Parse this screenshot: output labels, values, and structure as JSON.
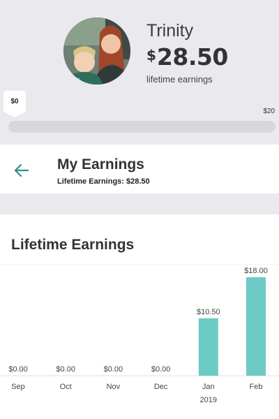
{
  "profile": {
    "name": "Trinity",
    "currency_symbol": "$",
    "amount": "28.50",
    "subtitle": "lifetime earnings"
  },
  "goal": {
    "start_label": "$0",
    "end_label": "$20",
    "progress_fraction": 0
  },
  "earnings_header": {
    "title": "My Earnings",
    "subtitle": "Lifetime Earnings: $28.50"
  },
  "chart_data": {
    "type": "bar",
    "title": "Lifetime Earnings",
    "categories": [
      "Sep",
      "Oct",
      "Nov",
      "Dec",
      "Jan",
      "Feb"
    ],
    "values": [
      0,
      0,
      0,
      0,
      10.5,
      18.0
    ],
    "value_labels": [
      "$0.00",
      "$0.00",
      "$0.00",
      "$0.00",
      "$10.50",
      "$18.00"
    ],
    "year_label": "2019",
    "ylim": [
      0,
      18
    ],
    "grid": false,
    "colors": {
      "bar": "#6ccbc4"
    }
  },
  "colors": {
    "accent": "#2a8f8a",
    "bar": "#6ccbc4",
    "background": "#e9e9ee"
  },
  "icons": {
    "back": "arrow-left-icon",
    "avatar": "avatar-photo"
  }
}
